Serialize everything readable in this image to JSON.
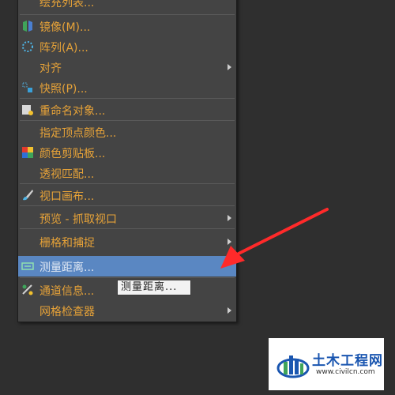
{
  "menu": {
    "items": [
      {
        "label": "绘充列表..."
      },
      {
        "label": "镜像(M)..."
      },
      {
        "label": "阵列(A)..."
      },
      {
        "label": "对齐"
      },
      {
        "label": "快照(P)..."
      },
      {
        "label": "重命名对象..."
      },
      {
        "label": "指定顶点颜色..."
      },
      {
        "label": "颜色剪贴板..."
      },
      {
        "label": "透视匹配..."
      },
      {
        "label": "视口画布..."
      },
      {
        "label": "预览 - 抓取视口"
      },
      {
        "label": "栅格和捕捉"
      },
      {
        "label": "测量距离..."
      },
      {
        "label": "通道信息..."
      },
      {
        "label": "网格检查器"
      }
    ]
  },
  "tooltip": {
    "text": "测量距离..."
  },
  "watermark": {
    "title": "土木工程网",
    "url": "www.civilcn.com"
  },
  "colors": {
    "menu_text": "#e6a238",
    "highlight": "#5a87c2",
    "annotation_arrow": "#ff2a2a"
  }
}
